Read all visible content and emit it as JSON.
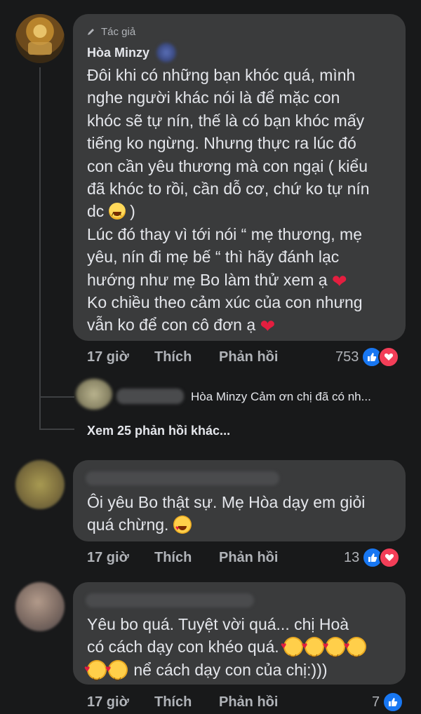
{
  "comment1": {
    "badge_label": "Tác giả",
    "author": "Hòa Minzy",
    "lines": [
      "Đôi khi có những bạn khóc quá, mình",
      "nghe người khác nói là để mặc con",
      "khóc sẽ tự nín, thế là có bạn khóc mấy",
      "tiếng ko ngừng. Nhưng thực ra lúc đó",
      "con cần yêu thương mà con ngại ( kiểu",
      "đã khóc to rồi, cần dỗ cơ, chứ ko tự nín",
      "dc",
      " )",
      "Lúc đó thay vì tới nói “ mẹ thương, mẹ",
      "yêu, nín đi mẹ bế “ thì hãy đánh lạc",
      "hướng như mẹ Bo làm thử xem ạ",
      "Ko chiều theo cảm xúc của con nhưng",
      "vẫn ko để con cô đơn ạ"
    ],
    "time": "17 giờ",
    "like": "Thích",
    "reply": "Phản hồi",
    "reaction_count": "753"
  },
  "reply_preview": {
    "text": "Hòa Minzy Cảm ơn chị đã có nh..."
  },
  "more_replies": "Xem 25 phản hồi khác...",
  "comment2": {
    "lines": [
      "Ôi yêu Bo thật sự. Mẹ Hòa dạy em giỏi",
      "quá chừng."
    ],
    "time": "17 giờ",
    "like": "Thích",
    "reply": "Phản hồi",
    "reaction_count": "13"
  },
  "comment3": {
    "lines": [
      "Yêu bo quá.  Tuyệt vời quá... chị Hoà",
      "có cách dạy con khéo quá.",
      " nể cách dạy con của chị:)))"
    ],
    "time": "17 giờ",
    "like": "Thích",
    "reply": "Phản hồi",
    "reaction_count": "7"
  },
  "icons": {
    "pencil": "pencil-icon",
    "like_reaction": "thumbs-up-icon",
    "love_reaction": "heart-icon"
  },
  "colors": {
    "background": "#18191a",
    "bubble": "#3a3b3c",
    "text": "#e4e6eb",
    "secondary": "#b0b3b8",
    "like_blue": "#1877f2",
    "love_red": "#f33e58"
  }
}
